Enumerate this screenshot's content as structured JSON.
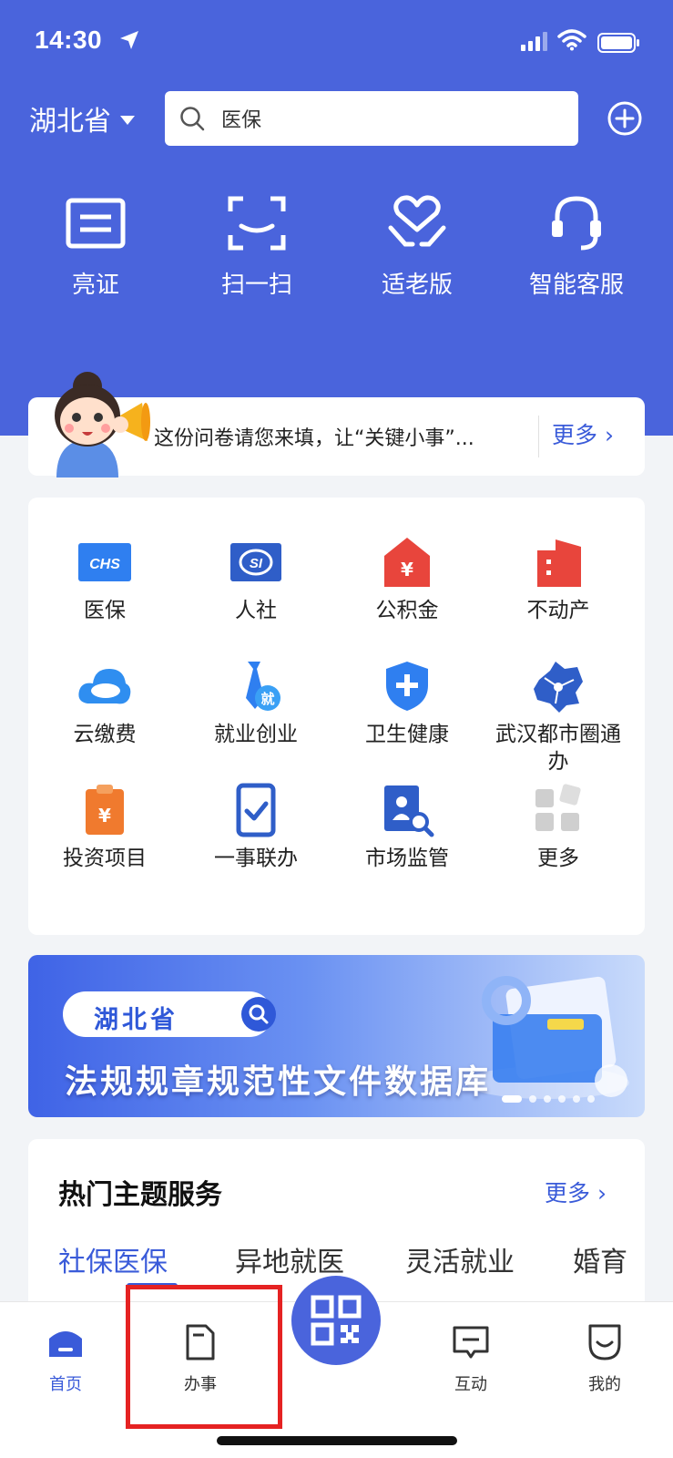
{
  "status_bar": {
    "time": "14:30"
  },
  "header": {
    "province": "湖北省",
    "search_placeholder": "医保",
    "quick_actions": [
      {
        "label": "亮证",
        "icon": "id-card-icon"
      },
      {
        "label": "扫一扫",
        "icon": "scan-icon"
      },
      {
        "label": "适老版",
        "icon": "elder-care-icon"
      },
      {
        "label": "智能客服",
        "icon": "headset-icon"
      }
    ]
  },
  "notice": {
    "text": "这份问卷请您来填，让“关键小事”...",
    "more": "更多"
  },
  "services": [
    {
      "label": "医保",
      "icon": "chs-medical-insurance-icon"
    },
    {
      "label": "人社",
      "icon": "social-security-icon"
    },
    {
      "label": "公积金",
      "icon": "housing-fund-icon"
    },
    {
      "label": "不动产",
      "icon": "real-estate-icon"
    },
    {
      "label": "云缴费",
      "icon": "cloud-payment-icon"
    },
    {
      "label": "就业创业",
      "icon": "employment-icon"
    },
    {
      "label": "卫生健康",
      "icon": "health-shield-icon"
    },
    {
      "label": "武汉都市圈通办",
      "icon": "wuhan-map-icon"
    },
    {
      "label": "投资项目",
      "icon": "investment-clipboard-icon"
    },
    {
      "label": "一事联办",
      "icon": "checklist-phone-icon"
    },
    {
      "label": "市场监管",
      "icon": "market-supervision-icon"
    },
    {
      "label": "更多",
      "icon": "more-grid-icon"
    }
  ],
  "banner": {
    "pill": "湖北省",
    "title": "法规规章规范性文件数据库"
  },
  "hot_topics": {
    "title": "热门主题服务",
    "more": "更多",
    "tabs": [
      "社保医保",
      "异地就医",
      "灵活就业",
      "婚育"
    ]
  },
  "tab_bar": [
    {
      "label": "首页",
      "active": true
    },
    {
      "label": "办事",
      "active": false
    },
    {
      "label": "互动",
      "active": false
    },
    {
      "label": "我的",
      "active": false
    }
  ],
  "colors": {
    "brand": "#4a64dc",
    "link": "#3a5bd9",
    "highlight": "#e52222"
  }
}
